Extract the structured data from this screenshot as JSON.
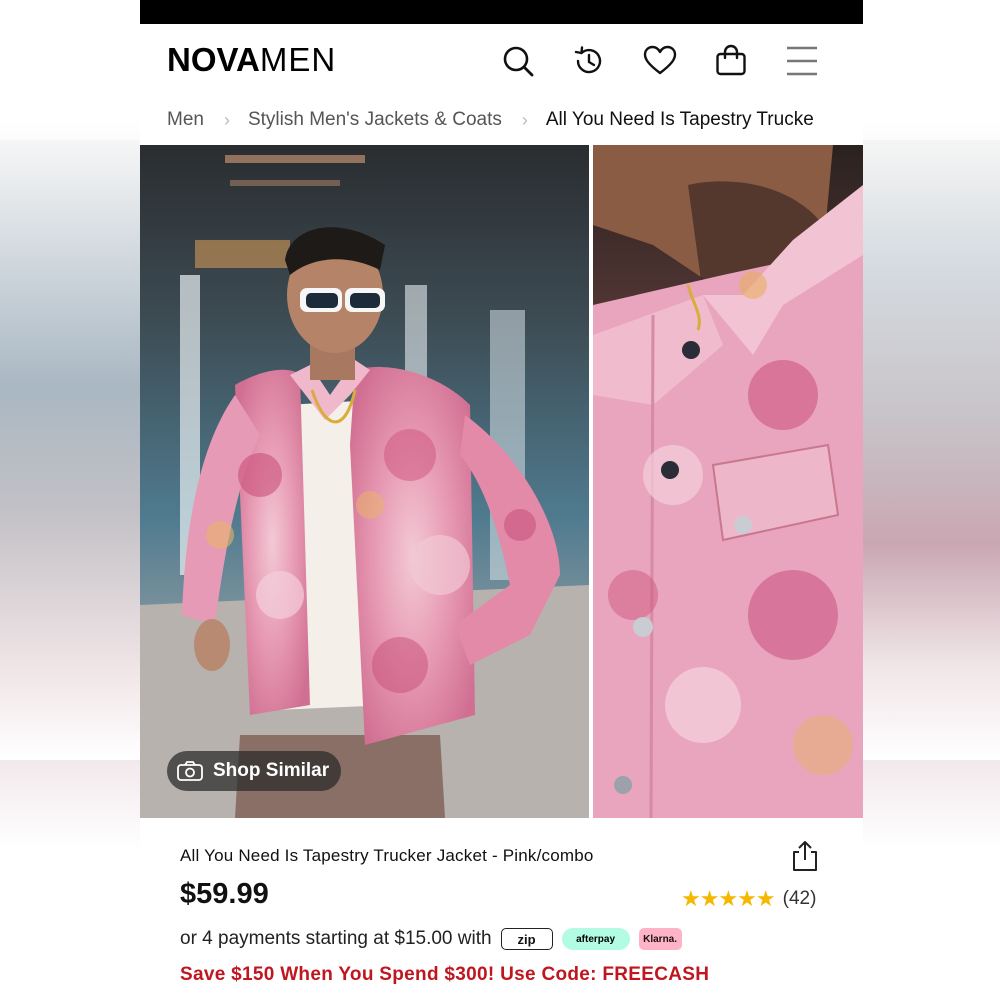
{
  "brand": {
    "bold": "NOVA",
    "light": "MEN"
  },
  "header": {
    "icons": [
      "search-icon",
      "history-icon",
      "heart-icon",
      "bag-icon",
      "menu-icon"
    ]
  },
  "breadcrumb": [
    {
      "label": "Men"
    },
    {
      "label": "Stylish Men's Jackets & Coats"
    },
    {
      "label": "All You Need Is Tapestry Trucke"
    }
  ],
  "gallery": {
    "shop_similar": "Shop Similar"
  },
  "product": {
    "title": "All You Need Is Tapestry Trucker Jacket - Pink/combo",
    "price": "$59.99",
    "stars": "★★★★★",
    "stars_value": 5,
    "review_count": "(42)",
    "payment_text": "or 4 payments starting at $15.00 with",
    "payment_badges": {
      "zip": "zip",
      "afterpay": "afterpay",
      "klarna": "Klarna."
    },
    "promo": "Save $150 When You Spend $300! Use Code: FREECASH"
  },
  "colors": {
    "promo": "#c0161f",
    "star": "#f5b800",
    "jacket_pink": "#e8a0b8"
  }
}
